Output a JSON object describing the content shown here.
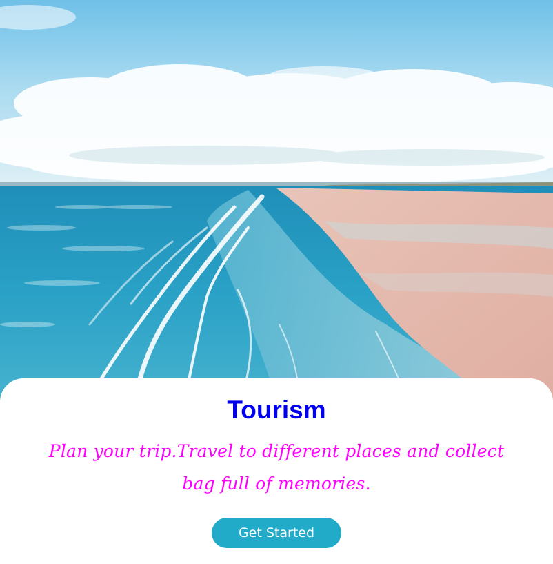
{
  "hero": {
    "image": "beach-coastline-aerial-photo"
  },
  "card": {
    "title": "Tourism",
    "tagline": "Plan your trip.Travel to different places and collect bag full of memories.",
    "cta_label": "Get Started"
  },
  "colors": {
    "title": "#0000ee",
    "tagline": "#ff00ff",
    "button": "#22aac9",
    "button_text": "#ffffff",
    "sky": "#7ec6e6",
    "sea": "#2b9fc4",
    "sand": "#e6b9ad"
  }
}
